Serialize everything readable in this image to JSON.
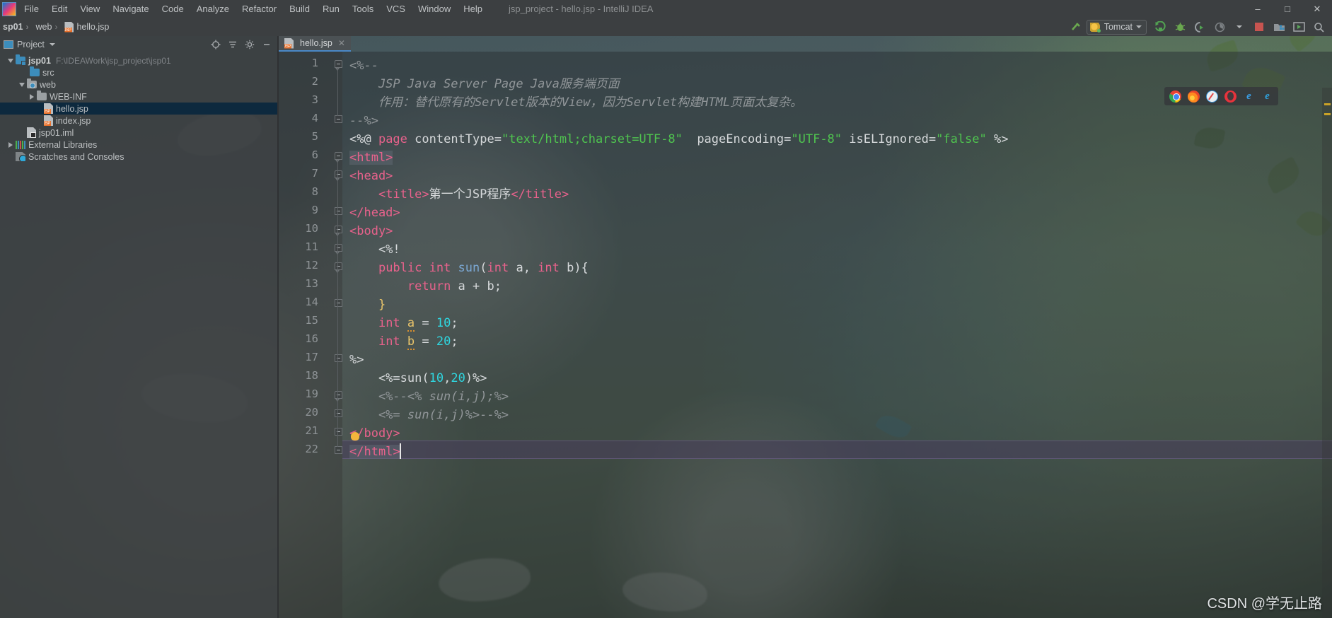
{
  "window": {
    "title": "jsp_project - hello.jsp - IntelliJ IDEA",
    "minimize": "–",
    "maximize": "□",
    "close": "✕"
  },
  "menu": {
    "items": [
      {
        "label": "File"
      },
      {
        "label": "Edit"
      },
      {
        "label": "View"
      },
      {
        "label": "Navigate"
      },
      {
        "label": "Code"
      },
      {
        "label": "Analyze"
      },
      {
        "label": "Refactor"
      },
      {
        "label": "Build"
      },
      {
        "label": "Run"
      },
      {
        "label": "Tools"
      },
      {
        "label": "VCS"
      },
      {
        "label": "Window"
      },
      {
        "label": "Help"
      }
    ]
  },
  "navbar": {
    "breadcrumbs": [
      {
        "label": "sp01"
      },
      {
        "label": "web"
      },
      {
        "label": "hello.jsp",
        "icon": "jsp-file-icon"
      }
    ],
    "separator": "›",
    "run_config": {
      "label": "Tomcat",
      "icon": "tomcat-icon",
      "dropdown_icon": "chevron-down-icon"
    },
    "actions": [
      {
        "name": "build-hammer-icon",
        "glyph": "⚒"
      },
      {
        "name": "run-icon",
        "glyph": "▶"
      },
      {
        "name": "debug-icon",
        "glyph": "✵"
      },
      {
        "name": "run-with-coverage-icon",
        "glyph": "◑"
      },
      {
        "name": "profile-icon",
        "glyph": "◔"
      },
      {
        "name": "stop-icon",
        "glyph": "■"
      },
      {
        "name": "attach-debugger-icon",
        "glyph": "⬚"
      },
      {
        "name": "open-in-browser-icon",
        "glyph": "▷"
      }
    ]
  },
  "project_pane": {
    "title": "Project",
    "dropdown_icon": "chevron-down-icon",
    "header_actions": [
      {
        "name": "locate-target-icon",
        "glyph": "⊕"
      },
      {
        "name": "collapse-all-icon",
        "glyph": "≡"
      },
      {
        "name": "settings-gear-icon",
        "glyph": "⚙"
      },
      {
        "name": "hide-panel-icon",
        "glyph": "−"
      }
    ],
    "tree": [
      {
        "label": "jsp01",
        "path": "F:\\IDEAWork\\jsp_project\\jsp01",
        "depth": 0,
        "twisty": "down",
        "icon": "module-folder-icon",
        "bold": true,
        "selected": false
      },
      {
        "label": "src",
        "path": "",
        "depth": 1,
        "twisty": "none",
        "icon": "source-folder-icon",
        "bold": false,
        "selected": false
      },
      {
        "label": "web",
        "path": "",
        "depth": 1,
        "twisty": "down",
        "icon": "web-folder-icon",
        "bold": false,
        "selected": false
      },
      {
        "label": "WEB-INF",
        "path": "",
        "depth": 2,
        "twisty": "right",
        "icon": "folder-icon",
        "bold": false,
        "selected": false
      },
      {
        "label": "hello.jsp",
        "path": "",
        "depth": 2,
        "twisty": "none",
        "icon": "jsp-file-icon",
        "bold": false,
        "selected": true
      },
      {
        "label": "index.jsp",
        "path": "",
        "depth": 2,
        "twisty": "none",
        "icon": "jsp-file-icon",
        "bold": false,
        "selected": false
      },
      {
        "label": "jsp01.iml",
        "path": "",
        "depth": 1,
        "twisty": "none",
        "icon": "iml-file-icon",
        "bold": false,
        "selected": false
      },
      {
        "label": "External Libraries",
        "path": "",
        "depth": 0,
        "twisty": "right",
        "icon": "libraries-icon",
        "bold": false,
        "selected": false
      },
      {
        "label": "Scratches and Consoles",
        "path": "",
        "depth": 0,
        "twisty": "none",
        "icon": "scratches-icon",
        "bold": false,
        "selected": false
      }
    ]
  },
  "editor": {
    "tabs": [
      {
        "label": "hello.jsp",
        "icon": "jsp-file-icon",
        "close_glyph": "✕",
        "active": true
      }
    ],
    "caret_line": 22,
    "lines": [
      {
        "n": 1,
        "fold": "start",
        "tokens": [
          {
            "t": "<%--",
            "c": "tok-cmt"
          }
        ]
      },
      {
        "n": 2,
        "fold": "none",
        "tokens": [
          {
            "t": "    JSP Java Server Page Java服务端页面",
            "c": "tok-cmt"
          }
        ]
      },
      {
        "n": 3,
        "fold": "none",
        "tokens": [
          {
            "t": "    作用：替代原有的Servlet版本的View，因为Servlet构建HTML页面太复杂。",
            "c": "tok-cmt"
          }
        ]
      },
      {
        "n": 4,
        "fold": "end",
        "tokens": [
          {
            "t": "--%>",
            "c": "tok-cmt"
          }
        ]
      },
      {
        "n": 5,
        "fold": "none",
        "tokens": [
          {
            "t": "<%@ ",
            "c": "tok-plain"
          },
          {
            "t": "page",
            "c": "tok-kw"
          },
          {
            "t": " contentType=",
            "c": "tok-plain"
          },
          {
            "t": "\"text/html;charset=UTF-8\"",
            "c": "tok-str"
          },
          {
            "t": "  pageEncoding=",
            "c": "tok-plain"
          },
          {
            "t": "\"UTF-8\"",
            "c": "tok-str"
          },
          {
            "t": " isELIgnored=",
            "c": "tok-plain"
          },
          {
            "t": "\"false\"",
            "c": "tok-str"
          },
          {
            "t": " %>",
            "c": "tok-plain"
          }
        ]
      },
      {
        "n": 6,
        "fold": "start",
        "sel": true,
        "tokens": [
          {
            "t": "<html>",
            "c": "tok-tag"
          }
        ]
      },
      {
        "n": 7,
        "fold": "start",
        "tokens": [
          {
            "t": "<head>",
            "c": "tok-tag"
          }
        ]
      },
      {
        "n": 8,
        "fold": "none",
        "tokens": [
          {
            "t": "    ",
            "c": "tok-plain"
          },
          {
            "t": "<title>",
            "c": "tok-tag"
          },
          {
            "t": "第一个JSP程序",
            "c": "tok-plain"
          },
          {
            "t": "</title>",
            "c": "tok-tag"
          }
        ]
      },
      {
        "n": 9,
        "fold": "end",
        "tokens": [
          {
            "t": "</head>",
            "c": "tok-tag"
          }
        ]
      },
      {
        "n": 10,
        "fold": "start",
        "tokens": [
          {
            "t": "<body>",
            "c": "tok-tag"
          }
        ]
      },
      {
        "n": 11,
        "fold": "start",
        "tokens": [
          {
            "t": "    <%!",
            "c": "tok-plain"
          }
        ]
      },
      {
        "n": 12,
        "fold": "start",
        "tokens": [
          {
            "t": "    ",
            "c": "tok-plain"
          },
          {
            "t": "public int ",
            "c": "tok-kw"
          },
          {
            "t": "sun",
            "c": "tok-meth"
          },
          {
            "t": "(",
            "c": "tok-plain"
          },
          {
            "t": "int",
            "c": "tok-kw"
          },
          {
            "t": " a, ",
            "c": "tok-plain"
          },
          {
            "t": "int",
            "c": "tok-kw"
          },
          {
            "t": " b){",
            "c": "tok-plain"
          }
        ]
      },
      {
        "n": 13,
        "fold": "none",
        "tokens": [
          {
            "t": "        ",
            "c": "tok-plain"
          },
          {
            "t": "return",
            "c": "tok-kw"
          },
          {
            "t": " a + b;",
            "c": "tok-plain"
          }
        ]
      },
      {
        "n": 14,
        "fold": "end",
        "tokens": [
          {
            "t": "    }",
            "c": "tok-brace"
          }
        ]
      },
      {
        "n": 15,
        "fold": "none",
        "tokens": [
          {
            "t": "    ",
            "c": "tok-plain"
          },
          {
            "t": "int",
            "c": "tok-kw"
          },
          {
            "t": " ",
            "c": "tok-plain"
          },
          {
            "t": "a",
            "c": "tok-warnv"
          },
          {
            "t": " = ",
            "c": "tok-plain"
          },
          {
            "t": "10",
            "c": "tok-num"
          },
          {
            "t": ";",
            "c": "tok-plain"
          }
        ]
      },
      {
        "n": 16,
        "fold": "none",
        "tokens": [
          {
            "t": "    ",
            "c": "tok-plain"
          },
          {
            "t": "int",
            "c": "tok-kw"
          },
          {
            "t": " ",
            "c": "tok-plain"
          },
          {
            "t": "b",
            "c": "tok-warnv"
          },
          {
            "t": " = ",
            "c": "tok-plain"
          },
          {
            "t": "20",
            "c": "tok-num"
          },
          {
            "t": ";",
            "c": "tok-plain"
          }
        ]
      },
      {
        "n": 17,
        "fold": "end",
        "tokens": [
          {
            "t": "%>",
            "c": "tok-plain"
          }
        ]
      },
      {
        "n": 18,
        "fold": "none",
        "tokens": [
          {
            "t": "    <%=sun(",
            "c": "tok-plain"
          },
          {
            "t": "10",
            "c": "tok-num"
          },
          {
            "t": ",",
            "c": "tok-plain"
          },
          {
            "t": "20",
            "c": "tok-num"
          },
          {
            "t": ")%>",
            "c": "tok-plain"
          }
        ]
      },
      {
        "n": 19,
        "fold": "start",
        "tokens": [
          {
            "t": "    <%--<% sun(i,j);%>",
            "c": "tok-cmt"
          }
        ]
      },
      {
        "n": 20,
        "fold": "end",
        "tokens": [
          {
            "t": "    <%= sun(i,j)%>--%>",
            "c": "tok-cmt"
          }
        ]
      },
      {
        "n": 21,
        "fold": "end",
        "bulb": true,
        "tokens": [
          {
            "t": "</body>",
            "c": "tok-tag"
          }
        ]
      },
      {
        "n": 22,
        "fold": "end",
        "current": true,
        "sel": true,
        "tokens": [
          {
            "t": "</html>",
            "c": "tok-tag"
          }
        ]
      }
    ],
    "browsers": [
      {
        "name": "chrome-icon"
      },
      {
        "name": "firefox-icon"
      },
      {
        "name": "safari-icon"
      },
      {
        "name": "opera-icon"
      },
      {
        "name": "edge-icon"
      },
      {
        "name": "internet-explorer-icon"
      }
    ]
  },
  "watermark": {
    "text": "CSDN @学无止路"
  },
  "colors": {
    "accent": "#4a88c7",
    "selection": "#0d293e",
    "tag": "#e8628c",
    "string": "#4fc44f",
    "number": "#2fd6e0",
    "comment": "#919699",
    "method": "#7ba8d4",
    "chrome_bg": "#3c3f41"
  }
}
